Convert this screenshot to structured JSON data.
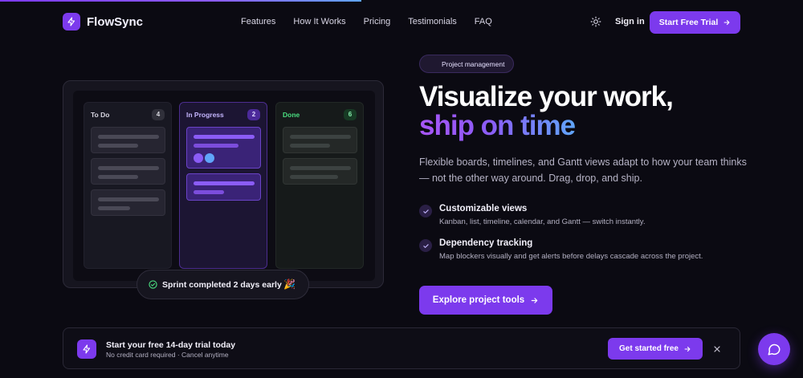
{
  "brand": {
    "name": "FlowSync",
    "logo_icon": "bolt-icon",
    "accent": "#7c3aed"
  },
  "nav": {
    "links": [
      "Features",
      "How It Works",
      "Pricing",
      "Testimonials",
      "FAQ"
    ],
    "theme_icon": "sun-icon",
    "signin_label": "Sign in",
    "cta_label": "Start Free Trial"
  },
  "board": {
    "columns": [
      {
        "title": "To Do",
        "count": "4"
      },
      {
        "title": "In Progress",
        "count": "2"
      },
      {
        "title": "Done",
        "count": "6"
      }
    ],
    "toast": "Sprint completed 2 days early",
    "toast_emoji": "🎉"
  },
  "hero": {
    "badge": "Project management",
    "title_line1": "Visualize your work,",
    "title_line2": "ship on time",
    "lead": "Flexible boards, timelines, and Gantt views adapt to how your team thinks — not the other way around. Drag, drop, and ship.",
    "features": [
      {
        "title": "Customizable views",
        "desc": "Kanban, list, timeline, calendar, and Gantt — switch instantly."
      },
      {
        "title": "Dependency tracking",
        "desc": "Map blockers visually and get alerts before delays cascade across the project."
      }
    ],
    "cta_label": "Explore project tools"
  },
  "banner": {
    "title": "Start your free 14-day trial today",
    "subtitle": "No credit card required · Cancel anytime",
    "cta_label": "Get started free"
  },
  "chat": {
    "icon": "chat-bubble-icon"
  }
}
